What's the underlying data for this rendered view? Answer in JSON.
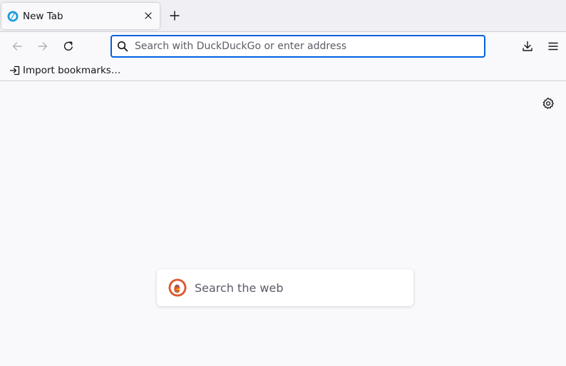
{
  "tabs": [
    {
      "title": "New Tab",
      "favicon": "firefox-favicon-icon",
      "close_icon": "close-icon"
    }
  ],
  "toolbar": {
    "new_tab_icon": "plus-icon",
    "back_icon": "back-arrow-icon",
    "forward_icon": "forward-arrow-icon",
    "reload_icon": "reload-icon",
    "downloads_icon": "download-icon",
    "menu_icon": "hamburger-menu-icon"
  },
  "urlbar": {
    "placeholder": "Search with DuckDuckGo or enter address",
    "value": "",
    "icon": "search-icon"
  },
  "bookmarks": {
    "items": [
      {
        "label": "Import bookmarks…",
        "icon": "import-icon"
      }
    ]
  },
  "newtab": {
    "settings_icon": "gear-icon",
    "search": {
      "placeholder": "Search the web",
      "value": "",
      "logo": "duckduckgo-logo-icon"
    }
  },
  "colors": {
    "accent": "#0061e0",
    "tabstrip_bg": "#f0f0f4",
    "page_bg": "#f9f9fb",
    "firefox_blue": "#1f9ce0",
    "ddg_red": "#de5833"
  }
}
